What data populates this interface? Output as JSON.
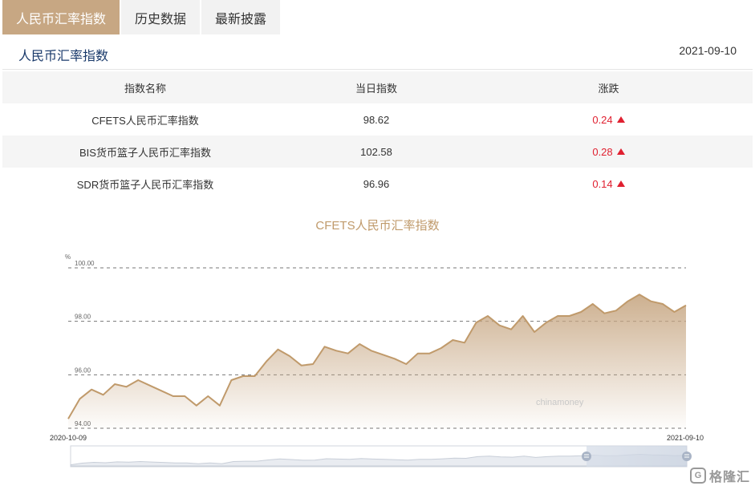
{
  "tabs": [
    {
      "label": "人民币汇率指数",
      "active": true
    },
    {
      "label": "历史数据",
      "active": false
    },
    {
      "label": "最新披露",
      "active": false
    }
  ],
  "section": {
    "title": "人民币汇率指数",
    "date": "2021-09-10"
  },
  "table": {
    "headers": [
      "指数名称",
      "当日指数",
      "涨跌"
    ],
    "rows": [
      {
        "name": "CFETS人民币汇率指数",
        "value": "98.62",
        "change": "0.24"
      },
      {
        "name": "BIS货币篮子人民币汇率指数",
        "value": "102.58",
        "change": "0.28"
      },
      {
        "name": "SDR货币篮子人民币汇率指数",
        "value": "96.96",
        "change": "0.14"
      }
    ]
  },
  "colors": {
    "accent": "#c7a783",
    "up": "#e02030",
    "line": "#c09a6b"
  },
  "icons": {
    "change_up": "triangle-up-icon",
    "brand": "brand-logo-icon"
  },
  "chart_data": {
    "type": "area",
    "title": "CFETS人民币汇率指数",
    "ylabel": "%",
    "ylim": [
      94,
      100
    ],
    "yticks": [
      "100.00",
      "98.00",
      "96.00",
      "94.00"
    ],
    "x_start": "2020-10-09",
    "x_end": "2021-09-10",
    "grid": true,
    "watermark": "chinamoney",
    "values": [
      94.35,
      95.1,
      95.45,
      95.25,
      95.65,
      95.55,
      95.8,
      95.6,
      95.4,
      95.2,
      95.2,
      94.85,
      95.2,
      94.85,
      95.8,
      95.95,
      95.95,
      96.5,
      96.95,
      96.7,
      96.35,
      96.4,
      97.05,
      96.9,
      96.8,
      97.15,
      96.9,
      96.75,
      96.6,
      96.4,
      96.8,
      96.8,
      97.0,
      97.3,
      97.2,
      97.95,
      98.2,
      97.85,
      97.7,
      98.2,
      97.6,
      97.95,
      98.2,
      98.2,
      98.35,
      98.65,
      98.3,
      98.4,
      98.75,
      99.0,
      98.75,
      98.65,
      98.35,
      98.6
    ]
  },
  "brand": {
    "name": "格隆汇",
    "icon_letter": "G"
  }
}
